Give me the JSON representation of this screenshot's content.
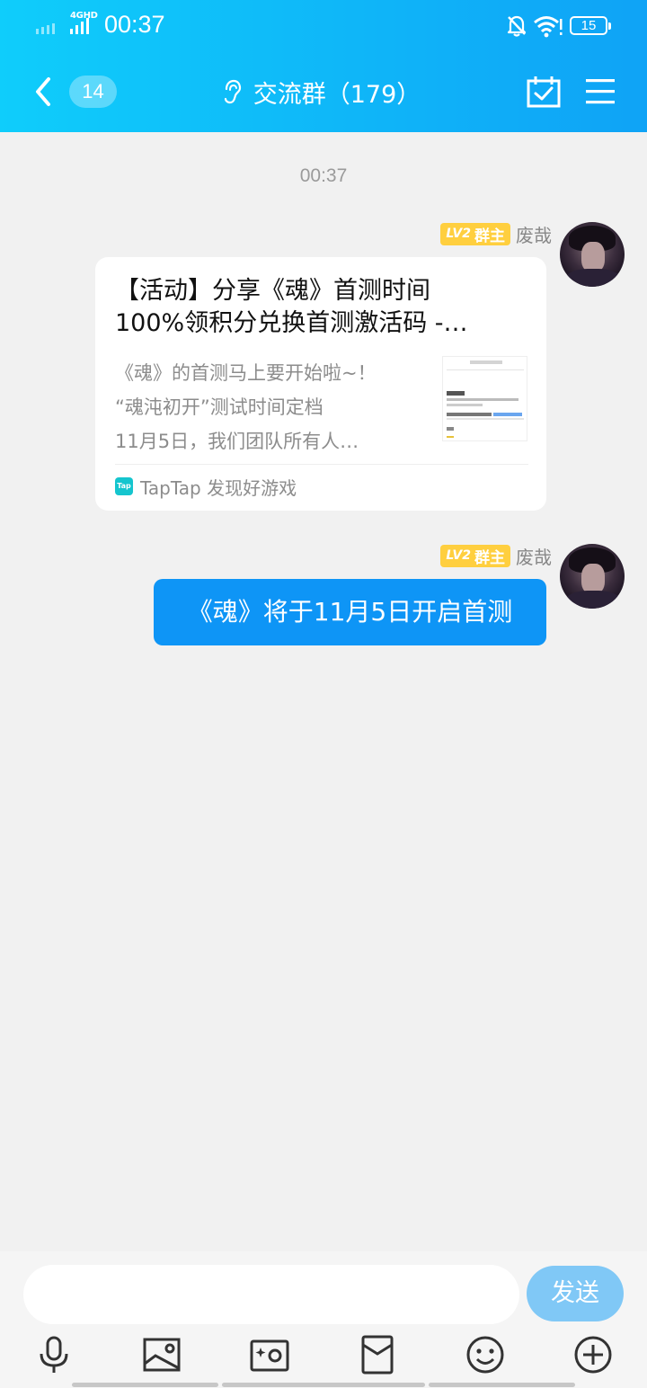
{
  "status_bar": {
    "network": "4GHD",
    "time": "00:37",
    "battery": "15"
  },
  "header": {
    "unread_count": "14",
    "group_title": "交流群（179）"
  },
  "chat": {
    "timestamp": "00:37",
    "messages": [
      {
        "type": "share_card",
        "level_badge": "LV2",
        "role_badge": "群主",
        "sender": "废哉",
        "title_lines": [
          "【活动】分享《魂》首测时间",
          "100%领积分兑换首测激活码 -…"
        ],
        "desc_lines": [
          "《魂》的首测马上要开始啦~！",
          "“魂沌初开”测试时间定档",
          "11月5日，我们团队所有人…"
        ],
        "source_icon_text": "Tap",
        "source": "TapTap 发现好游戏"
      },
      {
        "type": "text",
        "level_badge": "LV2",
        "role_badge": "群主",
        "sender": "废哉",
        "text": "《魂》将于11月5日开启首测"
      }
    ]
  },
  "input": {
    "placeholder": "",
    "send_label": "发送"
  },
  "toolbar": {
    "icons": [
      "microphone-icon",
      "image-icon",
      "camera-icon",
      "red-packet-icon",
      "emoji-icon",
      "plus-icon"
    ]
  },
  "colors": {
    "header_gradient_start": "#0fcdfb",
    "header_gradient_end": "#0fa3f6",
    "bubble_blue": "#0e95f6",
    "send_button": "#80c8f6",
    "level_badge": "#ffcf3f",
    "background": "#f1f1f1"
  }
}
